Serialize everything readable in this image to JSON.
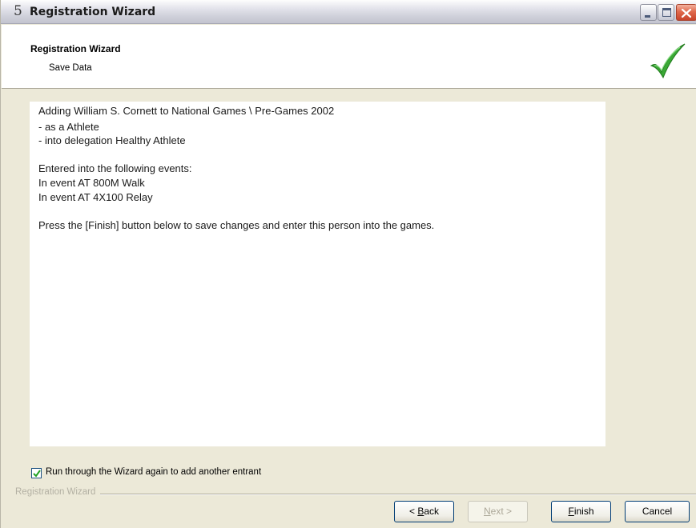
{
  "window": {
    "title": "Registration Wizard",
    "app_icon_glyph": "5",
    "controls": [
      "minimize",
      "maximize",
      "close"
    ]
  },
  "header": {
    "title": "Registration Wizard",
    "subtitle": "Save Data",
    "status_icon": "green-checkmark-icon",
    "status_color": "#2fa12f"
  },
  "content": {
    "lines": [
      "Adding William S. Cornett to National Games \\ Pre-Games 2002",
      "- as a Athlete",
      "- into delegation Healthy Athlete",
      "",
      "Entered into the following events:",
      "In event AT  800M Walk",
      "In event AT 4X100 Relay",
      "",
      "Press the [Finish] button below to save changes and enter this person into the games."
    ]
  },
  "options": {
    "repeat_label": "Run through the Wizard again to add another entrant",
    "repeat_checked": true
  },
  "footer": {
    "group_label": "Registration Wizard"
  },
  "buttons": {
    "back": {
      "prefix": "< ",
      "accel": "B",
      "rest": "ack",
      "enabled": true
    },
    "next": {
      "prefix": "",
      "accel": "N",
      "rest": "ext >",
      "enabled": false
    },
    "finish": {
      "prefix": "",
      "accel": "F",
      "rest": "inish",
      "enabled": true
    },
    "cancel": {
      "label": "Cancel",
      "enabled": true
    }
  }
}
